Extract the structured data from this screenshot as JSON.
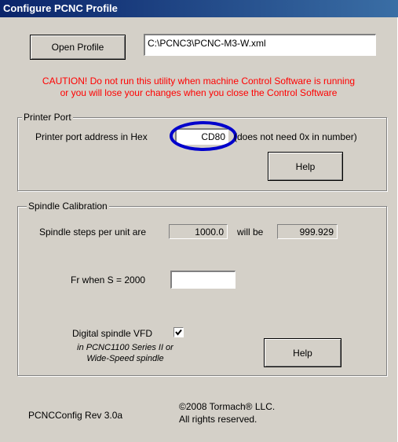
{
  "window": {
    "title": "Configure PCNC Profile"
  },
  "profile": {
    "open_button": "Open Profile",
    "path_value": "C:\\PCNC3\\PCNC-M3-W.xml"
  },
  "caution": {
    "line1": "CAUTION! Do not run this utility when machine Control Software is running",
    "line2": "or you will lose your changes when you close the Control Software",
    "color": "#ff0000"
  },
  "printer_port": {
    "legend": "Printer Port",
    "label": "Printer port address in Hex",
    "value": "CD80",
    "hint": "(does not need 0x in number)",
    "help_button": "Help",
    "highlight_color": "#0000cc"
  },
  "spindle": {
    "legend": "Spindle Calibration",
    "steps_label": "Spindle steps per unit are",
    "steps_value": "1000.0",
    "will_be_label": "will be",
    "will_be_value": "999.929",
    "fr_label": "Fr when S = 2000",
    "fr_value": "",
    "vfd_label": "Digital spindle VFD",
    "vfd_checked": true,
    "vfd_note_line1": "in PCNC1100 Series II or",
    "vfd_note_line2": "Wide-Speed spindle",
    "help_button": "Help"
  },
  "footer": {
    "version": "PCNCConfig Rev 3.0a",
    "copyright_line1": "©2008 Tormach® LLC.",
    "copyright_line2": "All rights reserved."
  },
  "colors": {
    "window_bg": "#d4d0c8",
    "title_bg": "#0a246a"
  }
}
